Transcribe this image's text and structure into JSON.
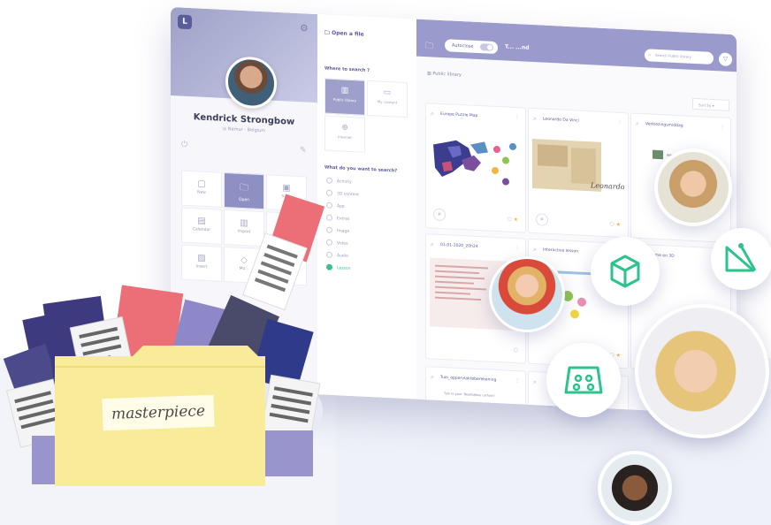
{
  "app": {
    "logo_letter": "L",
    "profile": {
      "name": "Kendrick Strongbow",
      "location": "Namur - Belgium"
    },
    "grid_buttons": [
      {
        "label": "New",
        "icon": "▢",
        "name": "new-button"
      },
      {
        "label": "Open",
        "icon": "🗀",
        "name": "open-button",
        "active": true
      },
      {
        "label": "Save",
        "icon": "▣",
        "name": "save-button"
      },
      {
        "label": "Calendar",
        "icon": "▤",
        "name": "calendar-button"
      },
      {
        "label": "Import",
        "icon": "▥",
        "name": "import-button"
      },
      {
        "label": "",
        "icon": "▦",
        "name": "grid-button-6"
      },
      {
        "label": "Insert",
        "icon": "▧",
        "name": "insert-button"
      },
      {
        "label": "Mo...",
        "icon": "◇",
        "name": "more-button"
      },
      {
        "label": "",
        "icon": "▨",
        "name": "grid-button-9"
      }
    ],
    "search_panel": {
      "title": "Open a file",
      "where_question": "Where to search ?",
      "options": [
        {
          "label": "Public library",
          "icon": "▥",
          "selected": true
        },
        {
          "label": "My content",
          "icon": "▭"
        },
        {
          "label": "Internet",
          "icon": "⊕"
        }
      ],
      "what_question": "What do you want to search?",
      "types": [
        "Activity",
        "3D content",
        "App",
        "Extras",
        "Image",
        "Video",
        "Audio",
        "Lesson"
      ],
      "selected_type": "Lesson"
    },
    "library": {
      "autoclose_label": "Autoclose",
      "title": "T...    ...nd",
      "search_placeholder": "Search Public library",
      "breadcrumb": "Public library",
      "sort_label": "Sort by",
      "cards": [
        {
          "title": "Europe Puzzle Map"
        },
        {
          "title": "Leonardo Da Vinci"
        },
        {
          "title": "Verkiezingsmiddag"
        },
        {
          "title": "01-01-2020_20h24"
        },
        {
          "title": "Interactive lesson"
        },
        {
          "title": "Sesame en 3D"
        },
        {
          "title": "Tuin_oppervlakteberekening"
        },
        {
          "title": ""
        }
      ],
      "footer_note": "Tuin to your 'Resetdjeeu cartoon'"
    }
  },
  "folder": {
    "label": "masterpiece"
  },
  "colors": {
    "accent": "#9a9bcc",
    "dark_accent": "#5b5c9a",
    "green": "#3cc18a",
    "folder": "#f8ec9a"
  }
}
